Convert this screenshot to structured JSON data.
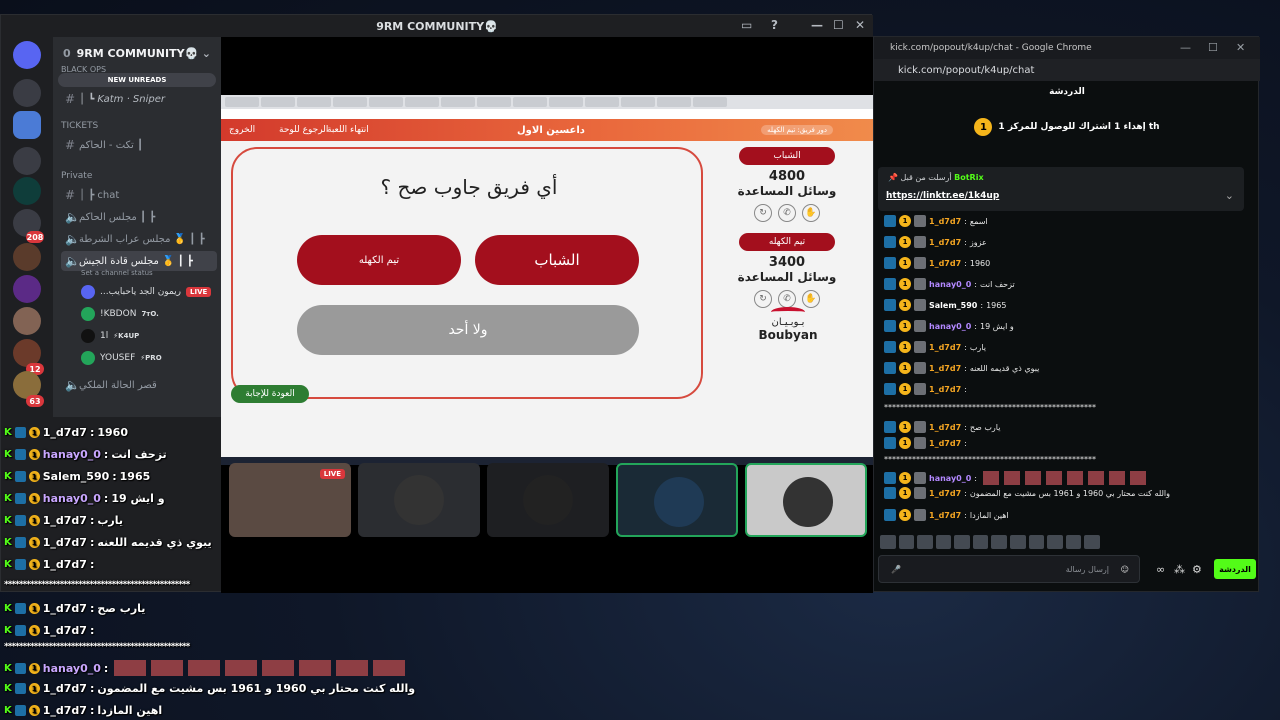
{
  "discord": {
    "window_title": "9RM COMMUNITY💀",
    "server_name": "9RM COMMUNITY💀",
    "member_count": "0",
    "new_unreads": "NEW UNREADS",
    "partial_top": "black ops",
    "channels_top": [
      {
        "label": "│ ┗ Katm · Sniper"
      }
    ],
    "category_tickets": "TICKETS",
    "ticket_channel": "تكت - الحاكم ┃",
    "category_private": "Private",
    "private_channels": [
      {
        "label": "│ ┣ chat"
      },
      {
        "label": "مجلس الحاكم ┃ ┣"
      },
      {
        "label": "مجلس عراب الشرطة 🥇 ┃ ┣"
      },
      {
        "label": "مجلس قادة الجيش 🥇 ┃ ┣"
      }
    ],
    "channel_status": "Set a channel status",
    "voice_users": [
      {
        "name": "...ريمون الجد ياحبايب",
        "tag": "LIVE"
      },
      {
        "name": "!KBDON",
        "tag": "7ᴛO."
      },
      {
        "name": "1l",
        "tag": "⚡K4UP"
      },
      {
        "name": "YOUSEF",
        "tag": "⚡PRO"
      }
    ],
    "last_channel": "قصر الحالة الملكي",
    "server_badges": [
      "208",
      "12",
      "63"
    ]
  },
  "quiz": {
    "page_title": "داعسين الاول",
    "nav_exit": "الخروج",
    "nav_board": "الرجوع للوحة",
    "nav_end": "انتهاء اللعبة",
    "turn_pill": "دور فريق: تيم الكهله",
    "question": "أي فريق جاوب صح ؟",
    "answer_a": "الشباب",
    "answer_b": "تيم الكهله",
    "answer_none": "ولا أحد",
    "back_to_answer": "العودة للإجابة",
    "team1": {
      "name": "الشباب",
      "score": "4800",
      "aids_label": "وسائل المساعدة"
    },
    "team2": {
      "name": "تيم الكهله",
      "score": "3400",
      "aids_label": "وسائل المساعدة"
    },
    "sponsor_ar": "بـوبـيـان",
    "sponsor_en": "Boubyan"
  },
  "tiles": {
    "live_label": "LIVE"
  },
  "kick": {
    "window_title": "kick.com/popout/k4up/chat - Google Chrome",
    "url": "kick.com/popout/k4up/chat",
    "header": "الدردشة",
    "goal_num": "1",
    "goal_text": "إهداء 1 اشتراك للوصول للمركز 1 th",
    "pinned_by": "أرسلت من قبل",
    "pinned_user": "BotRix",
    "pinned_link": "https://linktr.ee/1k4up",
    "messages": [
      {
        "user": "1_d7d7",
        "cls": "u-o",
        "text": "اسمع"
      },
      {
        "user": "1_d7d7",
        "cls": "u-o",
        "text": "عزوز"
      },
      {
        "user": "1_d7d7",
        "cls": "u-o",
        "text": "1960"
      },
      {
        "user": "hanay0_0",
        "cls": "u-p",
        "text": "تزحف انت"
      },
      {
        "user": "Salem_590",
        "cls": "u-w",
        "text": "1965"
      },
      {
        "user": "hanay0_0",
        "cls": "u-p",
        "text": "و ايش 19"
      },
      {
        "user": "1_d7d7",
        "cls": "u-o",
        "text": "يارب"
      },
      {
        "user": "1_d7d7",
        "cls": "u-o",
        "text": "يبوي ذي قديمه اللعنه"
      },
      {
        "user": "1_d7d7",
        "cls": "u-o",
        "text": ""
      },
      {
        "user": "",
        "cls": "u-w",
        "text": "*****************************************************"
      },
      {
        "user": "1_d7d7",
        "cls": "u-o",
        "text": "يارب صح"
      },
      {
        "user": "1_d7d7",
        "cls": "u-o",
        "text": ""
      },
      {
        "user": "",
        "cls": "u-w",
        "text": "*****************************************************"
      },
      {
        "user": "hanay0_0",
        "cls": "u-p",
        "text": ""
      },
      {
        "user": "1_d7d7",
        "cls": "u-o",
        "text": "والله كنت محتار بي 1960 و 1961 بس مشيت مع المضمون"
      },
      {
        "user": "1_d7d7",
        "cls": "u-o",
        "text": "اهين المازدا"
      }
    ],
    "input_placeholder": "إرسال رسالة",
    "send_label": "الدردشة"
  },
  "overlay": {
    "messages": [
      {
        "user": "1_d7d7",
        "text": "1960"
      },
      {
        "user": "hanay0_0",
        "text": "تزحف انت"
      },
      {
        "user": "Salem_590",
        "text": "1965"
      },
      {
        "user": "hanay0_0",
        "text": "و ايش 19"
      },
      {
        "user": "1_d7d7",
        "text": "يارب"
      },
      {
        "user": "1_d7d7",
        "text": "يبوي ذي قديمه اللعنه"
      },
      {
        "user": "1_d7d7",
        "text": ""
      },
      {
        "user": "",
        "text": "**************************************************"
      },
      {
        "user": "1_d7d7",
        "text": "يارب صح"
      },
      {
        "user": "1_d7d7",
        "text": ""
      },
      {
        "user": "",
        "text": "**************************************************"
      },
      {
        "user": "hanay0_0",
        "text": ""
      },
      {
        "user": "1_d7d7",
        "text": "والله كنت محتار بي 1960 و 1961 بس مشيت مع المضمون"
      },
      {
        "user": "1_d7d7",
        "text": "اهين المازدا"
      }
    ]
  },
  "colors": {
    "kick_green": "#53fc18",
    "quiz_red": "#a30f1d",
    "discord_bg": "#1e1f22"
  }
}
